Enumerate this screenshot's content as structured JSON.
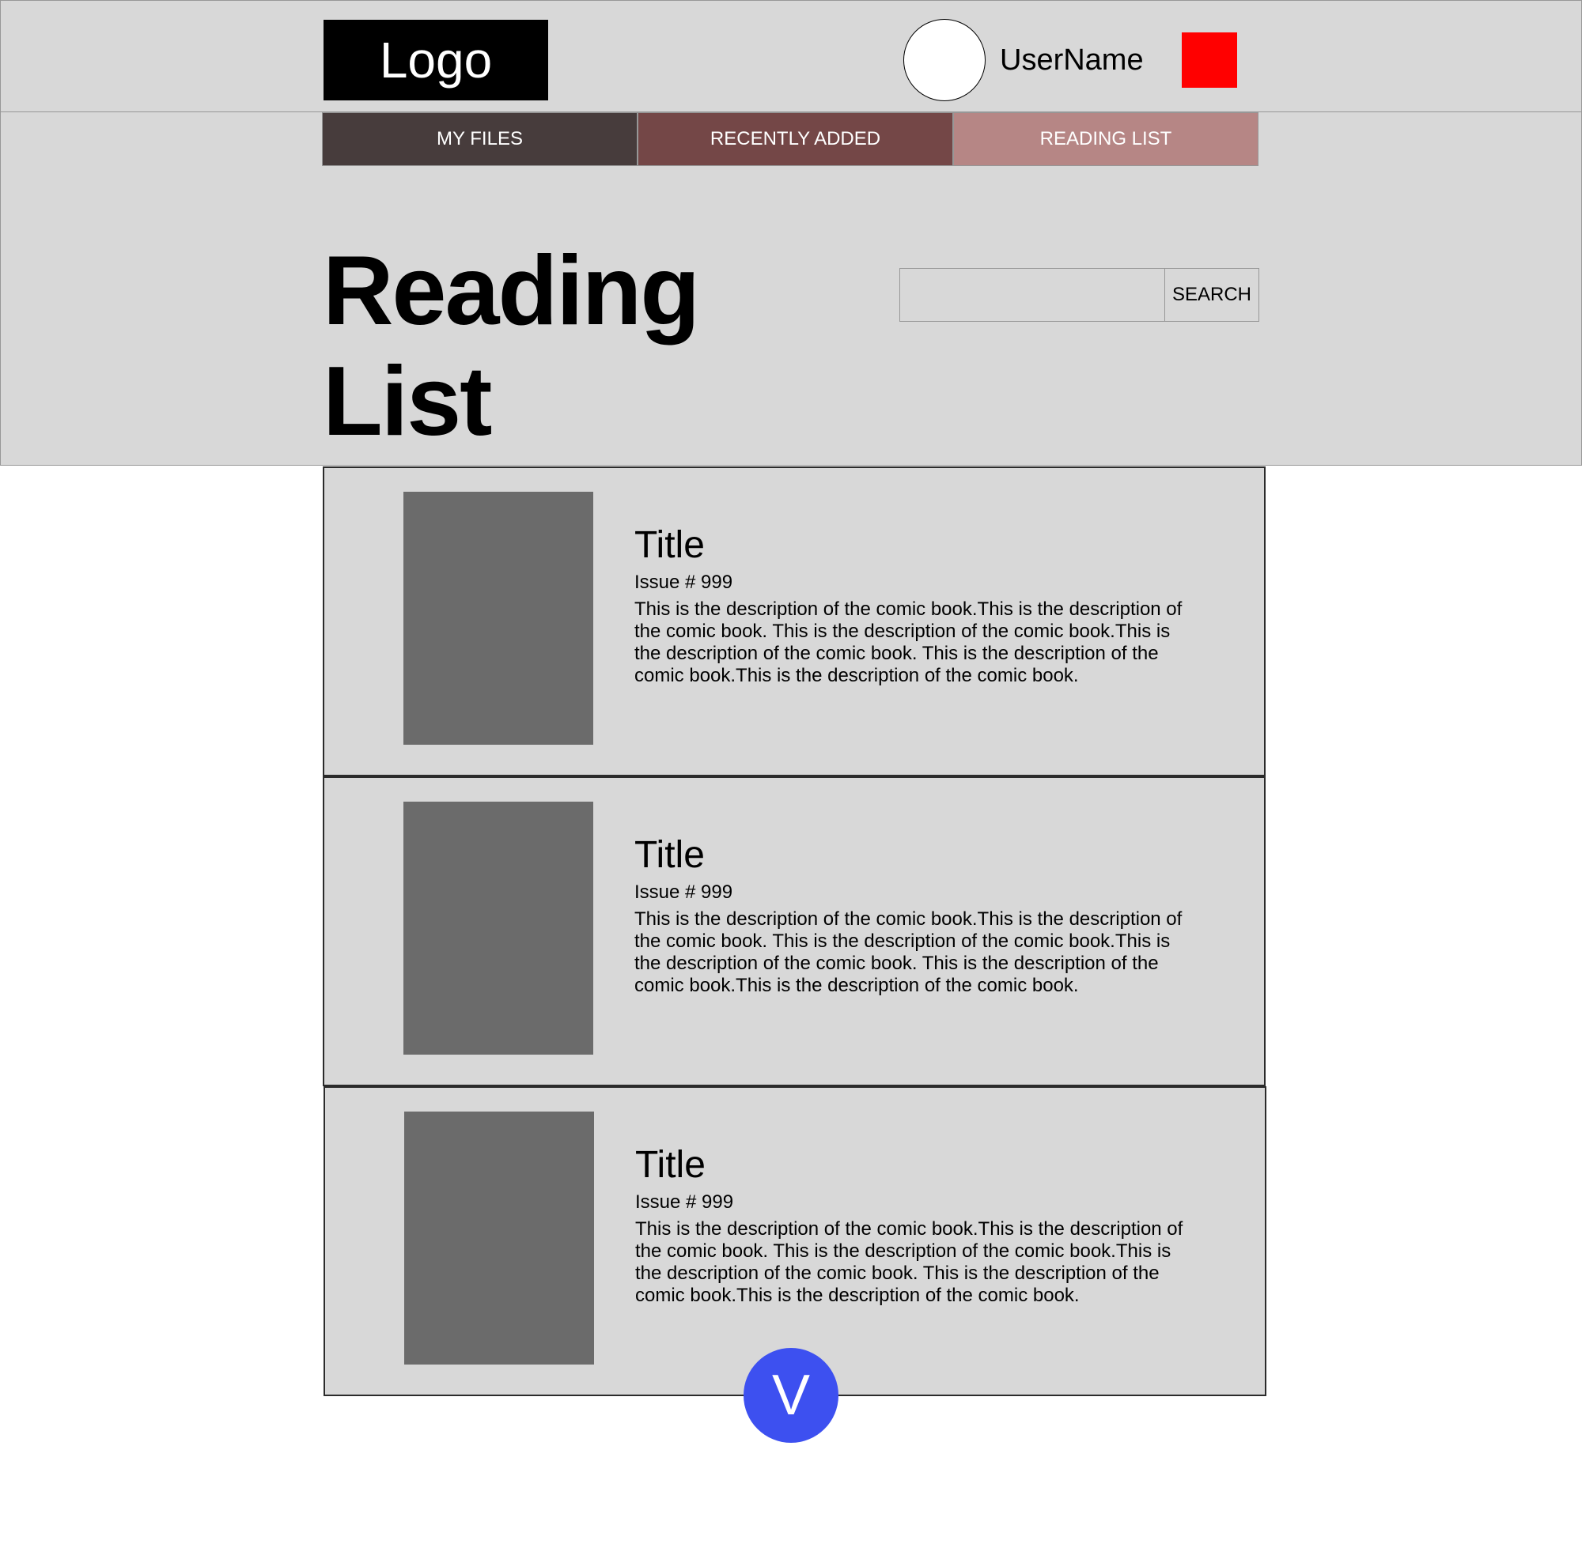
{
  "header": {
    "logo_text": "Logo",
    "username": "UserName"
  },
  "nav": {
    "tabs": [
      {
        "label": "MY FILES"
      },
      {
        "label": "RECENTLY ADDED"
      },
      {
        "label": "READING LIST"
      }
    ]
  },
  "page": {
    "title": "Reading List"
  },
  "search": {
    "value": "",
    "button_label": "SEARCH"
  },
  "items": [
    {
      "title": "Title",
      "issue": "Issue # 999",
      "description": "This is the description of the comic book.This is the description of the comic book. This is the description of the comic book.This is the description of the comic book. This is the description of the comic book.This is the description of the comic book."
    },
    {
      "title": "Title",
      "issue": "Issue # 999",
      "description": "This is the description of the comic book.This is the description of the comic book. This is the description of the comic book.This is the description of the comic book. This is the description of the comic book.This is the description of the comic book."
    },
    {
      "title": "Title",
      "issue": "Issue # 999",
      "description": "This is the description of the comic book.This is the description of the comic book. This is the description of the comic book.This is the description of the comic book. This is the description of the comic book.This is the description of the comic book."
    }
  ],
  "fab": {
    "label": "V"
  },
  "colors": {
    "header_bg": "#d8d8d8",
    "logo_bg": "#000000",
    "notification_square": "#ff0000",
    "tab_my_files": "#473c3c",
    "tab_recently_added": "#744747",
    "tab_reading_list": "#b68685",
    "cover_placeholder": "#6b6b6b",
    "fab_bg": "#3d50f0"
  }
}
